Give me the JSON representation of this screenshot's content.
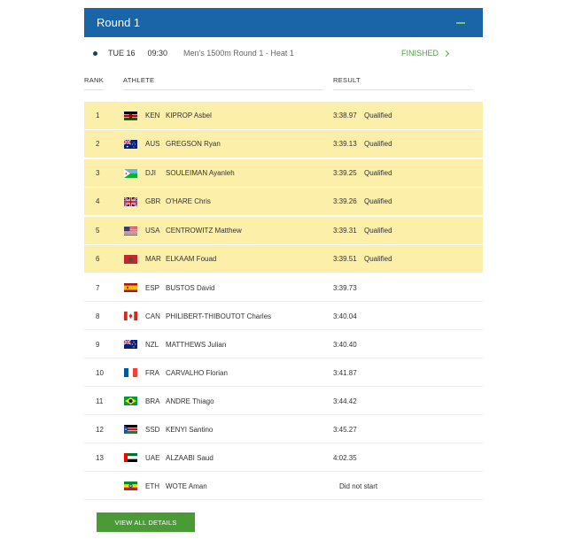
{
  "round": {
    "title": "Round 1"
  },
  "event": {
    "day": "TUE 16",
    "time": "09:30",
    "name": "Men's 1500m Round 1 - Heat 1",
    "status": "FINISHED"
  },
  "columns": {
    "rank": "RANK",
    "athlete": "ATHLETE",
    "result": "RESULT"
  },
  "colors": {
    "header": "#1a64a8",
    "qualified": "#fcefa9",
    "accent": "#4a9a36"
  },
  "rows": [
    {
      "rank": "1",
      "flag": "kenya-flag-icon",
      "code": "KEN",
      "name": "KIPROP Asbel",
      "result": "3:38.97",
      "note": "Qualified"
    },
    {
      "rank": "2",
      "flag": "australia-flag-icon",
      "code": "AUS",
      "name": "GREGSON Ryan",
      "result": "3:39.13",
      "note": "Qualified"
    },
    {
      "rank": "3",
      "flag": "djibouti-flag-icon",
      "code": "DJI",
      "name": "SOULEIMAN Ayanleh",
      "result": "3:39.25",
      "note": "Qualified"
    },
    {
      "rank": "4",
      "flag": "uk-flag-icon",
      "code": "GBR",
      "name": "O'HARE Chris",
      "result": "3:39.26",
      "note": "Qualified"
    },
    {
      "rank": "5",
      "flag": "usa-flag-icon",
      "code": "USA",
      "name": "CENTROWITZ Matthew",
      "result": "3:39.31",
      "note": "Qualified"
    },
    {
      "rank": "6",
      "flag": "morocco-flag-icon",
      "code": "MAR",
      "name": "ELKAAM Fouad",
      "result": "3:39.51",
      "note": "Qualified"
    },
    {
      "rank": "7",
      "flag": "spain-flag-icon",
      "code": "ESP",
      "name": "BUSTOS David",
      "result": "3:39.73",
      "note": ""
    },
    {
      "rank": "8",
      "flag": "canada-flag-icon",
      "code": "CAN",
      "name": "PHILIBERT-THIBOUTOT Charles",
      "result": "3:40.04",
      "note": ""
    },
    {
      "rank": "9",
      "flag": "new-zealand-flag-icon",
      "code": "NZL",
      "name": "MATTHEWS Julian",
      "result": "3:40.40",
      "note": ""
    },
    {
      "rank": "10",
      "flag": "france-flag-icon",
      "code": "FRA",
      "name": "CARVALHO Florian",
      "result": "3:41.87",
      "note": ""
    },
    {
      "rank": "11",
      "flag": "brazil-flag-icon",
      "code": "BRA",
      "name": "ANDRE Thiago",
      "result": "3:44.42",
      "note": ""
    },
    {
      "rank": "12",
      "flag": "south-sudan-flag-icon",
      "code": "SSD",
      "name": "KENYI Santino",
      "result": "3:45.27",
      "note": ""
    },
    {
      "rank": "13",
      "flag": "uae-flag-icon",
      "code": "UAE",
      "name": "ALZAABI Saud",
      "result": "4:02.35",
      "note": ""
    },
    {
      "rank": "",
      "flag": "ethiopia-flag-icon",
      "code": "ETH",
      "name": "WOTE Aman",
      "result": "Did not start",
      "note": ""
    }
  ],
  "button": {
    "label": "VIEW ALL DETAILS"
  }
}
